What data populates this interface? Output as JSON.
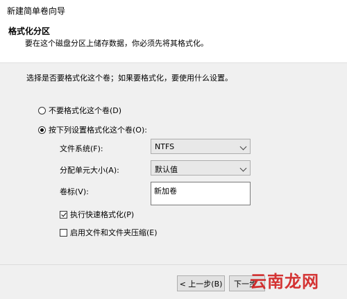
{
  "window": {
    "title": "新建简单卷向导"
  },
  "header": {
    "title": "格式化分区",
    "description": "要在这个磁盘分区上储存数据，你必须先将其格式化。"
  },
  "main": {
    "prompt": "选择是否要格式化这个卷；如果要格式化，要使用什么设置。",
    "option_no_format": "不要格式化这个卷(D)",
    "option_format": "按下列设置格式化这个卷(O):",
    "filesystem_label": "文件系统(F):",
    "filesystem_value": "NTFS",
    "alloc_label": "分配单元大小(A):",
    "alloc_value": "默认值",
    "volume_label_label": "卷标(V):",
    "volume_label_value": "新加卷",
    "quick_format_label": "执行快速格式化(P)",
    "compression_label": "启用文件和文件夹压缩(E)",
    "quick_format_checked": true,
    "compression_checked": false,
    "selected_option": "format"
  },
  "footer": {
    "back_label": "< 上一步(B)",
    "next_label": "下一步"
  },
  "watermark": "云南龙网"
}
